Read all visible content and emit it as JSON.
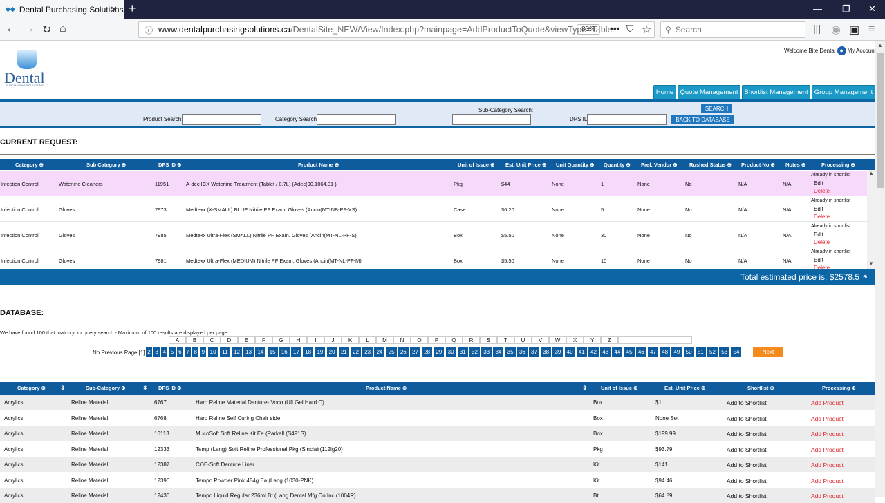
{
  "browser": {
    "tab_title": "Dental Purchasing Solutions",
    "url_domain": "www.dentalpurchasingsolutions.ca",
    "url_path": "/DentalSite_NEW/View/Index.php?mainpage=AddProductToQuote&viewType=Table",
    "zoom": "80%",
    "search_placeholder": "Search"
  },
  "logo": {
    "word": "Dental",
    "sub": "PURCHASING SOLUTIONS"
  },
  "header": {
    "welcome": "Welcome Bite Dental",
    "account": "My Account"
  },
  "nav": [
    "Home",
    "Quote Management",
    "Shortlist Management",
    "Group Management"
  ],
  "search": {
    "product_label": "Product Search:",
    "category_label": "Category Search:",
    "subcategory_label": "Sub-Category Search:",
    "dpsid_label": "DPS ID:",
    "search_btn": "SEARCH",
    "back_btn": "BACK TO DATABASE"
  },
  "current": {
    "title": "CURRENT REQUEST:",
    "headers": [
      "Category",
      "Sub Category",
      "DPS ID",
      "Product Name",
      "Unit of Issue",
      "Est. Unit Price",
      "Unit Quantity",
      "Quantity",
      "Pref. Vendor",
      "Rushed Status",
      "Product No",
      "Notes",
      "Processing"
    ],
    "rows": [
      {
        "category": "Infection Control",
        "sub": "Waterline Cleaners",
        "id": "11951",
        "name": "A-dec ICX Waterline Treatment (Tablet / 0.7L) (Adec(90.1064.01 )",
        "unit": "Pkg",
        "price": "$44",
        "uq": "None",
        "qty": "1",
        "vendor": "None",
        "rushed": "No",
        "prodno": "N/A",
        "notes": "N/A",
        "status": "Already in shortlist",
        "edit": "Edit",
        "delete": "Delete"
      },
      {
        "category": "Infection Control",
        "sub": "Gloves",
        "id": "7973",
        "name": "Medtexx (X-SMALL) BLUE Nitrile PF Exam. Gloves (Ancin(MT-NB-PF-XS)",
        "unit": "Case",
        "price": "$6.20",
        "uq": "None",
        "qty": "5",
        "vendor": "None",
        "rushed": "No",
        "prodno": "N/A",
        "notes": "N/A",
        "status": "Already in shortlist",
        "edit": "Edit",
        "delete": "Delete"
      },
      {
        "category": "Infection Control",
        "sub": "Gloves",
        "id": "7985",
        "name": "Medtexx Ultra-Flex (SMALL) Nitrile PF Exam. Gloves (Ancin(MT-NL-PF-S)",
        "unit": "Box",
        "price": "$5.50",
        "uq": "None",
        "qty": "30",
        "vendor": "None",
        "rushed": "No",
        "prodno": "N/A",
        "notes": "N/A",
        "status": "Already in shortlist",
        "edit": "Edit",
        "delete": "Delete"
      },
      {
        "category": "Infection Control",
        "sub": "Gloves",
        "id": "7981",
        "name": "Medtexx Ultra-Flex (MEDIUM) Nitrile PF Exam. Gloves (Ancin(MT-NL-PF-M)",
        "unit": "Box",
        "price": "$5.50",
        "uq": "None",
        "qty": "10",
        "vendor": "None",
        "rushed": "No",
        "prodno": "N/A",
        "notes": "N/A",
        "status": "Already in shortlist",
        "edit": "Edit",
        "delete": "Delete"
      }
    ],
    "total": "Total estimated price is: $2578.5"
  },
  "database": {
    "title": "DATABASE:",
    "found": "We have found 100 that match your query search - Maximum of 100 results are displayed per page.",
    "letters": [
      "A",
      "B",
      "C",
      "D",
      "E",
      "F",
      "G",
      "H",
      "I",
      "J",
      "K",
      "L",
      "M",
      "N",
      "O",
      "P",
      "Q",
      "R",
      "S",
      "T",
      "U",
      "V",
      "W",
      "X",
      "Y",
      "Z"
    ],
    "no_prev": "No Previous Page [1]",
    "pages": [
      "2",
      "3",
      "4",
      "5",
      "6",
      "7",
      "8",
      "9",
      "10",
      "11",
      "12",
      "13",
      "14",
      "15",
      "16",
      "17",
      "18",
      "19",
      "20",
      "21",
      "22",
      "23",
      "24",
      "25",
      "26",
      "27",
      "28",
      "29",
      "30",
      "31",
      "32",
      "33",
      "34",
      "35",
      "36",
      "37",
      "38",
      "39",
      "40",
      "41",
      "42",
      "43",
      "44",
      "45",
      "46",
      "47",
      "48",
      "49",
      "50",
      "51",
      "52",
      "53",
      "54"
    ],
    "next": "Next",
    "headers": [
      "Category",
      "Sub-Category",
      "DPS ID",
      "Product Name",
      "Unit of Issue",
      "Est. Unit Price",
      "Shortlist",
      "Processing"
    ],
    "rows": [
      {
        "category": "Acrylics",
        "sub": "Reline Material",
        "id": "6767",
        "name": "Hard Reline Material Denture- Voco (Ufi Gel Hard C)",
        "unit": "Box",
        "price": "$1",
        "shortlist": "Add to Shortlist",
        "add": "Add Product"
      },
      {
        "category": "Acrylics",
        "sub": "Reline Material",
        "id": "6768",
        "name": "Hard Reline Self Curing Chair side",
        "unit": "Box",
        "price": "None Set",
        "shortlist": "Add to Shortlist",
        "add": "Add Product"
      },
      {
        "category": "Acrylics",
        "sub": "Reline Material",
        "id": "10113",
        "name": "MucoSoft Soft Reline Kit Ea (Parkell (S491S)",
        "unit": "Box",
        "price": "$199.99",
        "shortlist": "Add to Shortlist",
        "add": "Add Product"
      },
      {
        "category": "Acrylics",
        "sub": "Reline Material",
        "id": "12333",
        "name": "Temp (Lang) Soft Reline Professional Pkg.(Sinclair(112lg20)",
        "unit": "Pkg",
        "price": "$93.79",
        "shortlist": "Add to Shortlist",
        "add": "Add Product"
      },
      {
        "category": "Acrylics",
        "sub": "Reline Material",
        "id": "12387",
        "name": "COE-Soft Denture Liner",
        "unit": "Kit",
        "price": "$141",
        "shortlist": "Add to Shortlist",
        "add": "Add Product"
      },
      {
        "category": "Acrylics",
        "sub": "Reline Material",
        "id": "12396",
        "name": "Tempo Powder Pink 454g Ea (Lang (1030-PNK)",
        "unit": "Kit",
        "price": "$94.46",
        "shortlist": "Add to Shortlist",
        "add": "Add Product"
      },
      {
        "category": "Acrylics",
        "sub": "Reline Material",
        "id": "12436",
        "name": "Tempo Liquid Regular 236ml Bt (Lang Dental Mfg Co Inc (1004R)",
        "unit": "Btl",
        "price": "$64.89",
        "shortlist": "Add to Shortlist",
        "add": "Add Product"
      }
    ]
  },
  "colors": {
    "header_blue": "#0e5c9e",
    "nav_teal": "#1b9ac7",
    "highlight_row": "#f6d9fb",
    "delete_red": "#e0242a",
    "next_orange": "#f58a1f"
  }
}
